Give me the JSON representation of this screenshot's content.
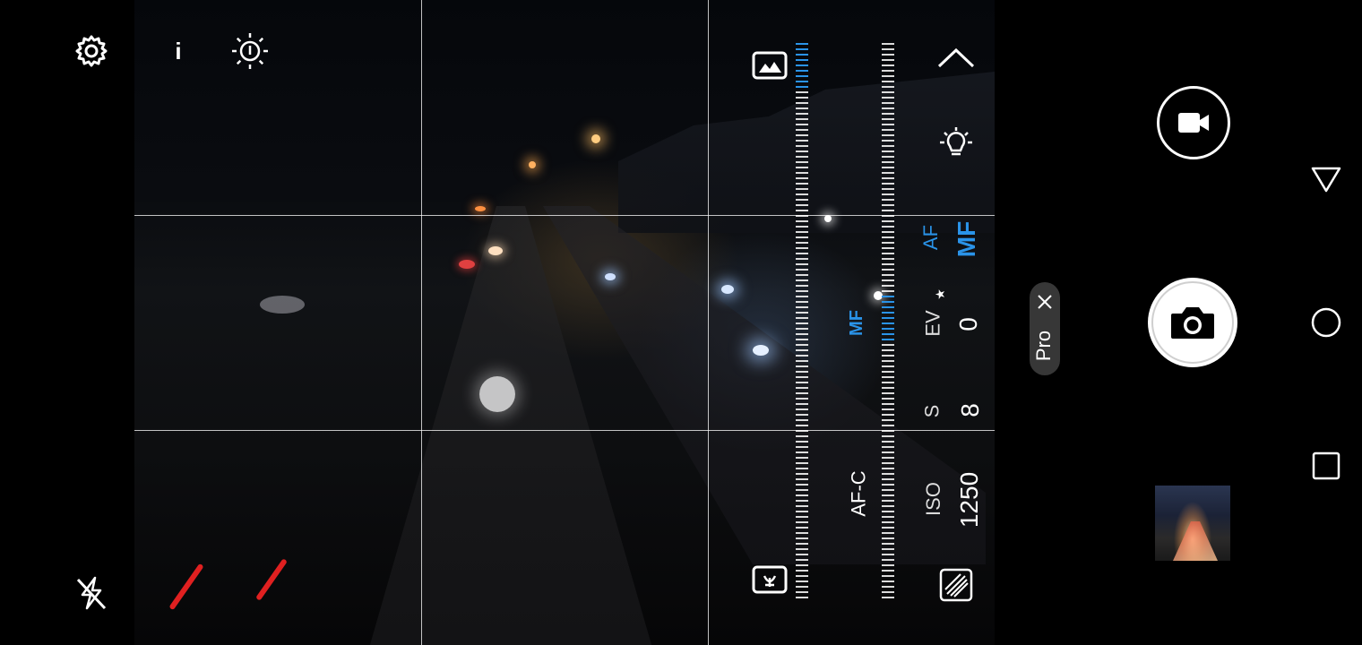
{
  "top_bar": {
    "settings_icon": "gear-icon",
    "info_label": "i",
    "light_icon": "brightness-icon",
    "flash_icon": "flash-off-icon"
  },
  "pro_controls": {
    "mode_icon_top": "landscape-icon",
    "mode_icon_bottom": "macro-flower-icon",
    "collapse_icon": "chevron-up-icon",
    "white_balance_icon": "bulb-icon",
    "focus_mode_icon": "stripe-square-icon",
    "focus": {
      "af_label": "AF",
      "mf_label": "MF",
      "mf_marker": "MF",
      "af_c_label": "AF-C"
    },
    "ev": {
      "label": "EV",
      "value": "0"
    },
    "shutter": {
      "label": "S",
      "value": "8"
    },
    "iso": {
      "label": "ISO",
      "value": "1250"
    }
  },
  "mode_pill": {
    "label": "Pro",
    "close_icon": "close-icon"
  },
  "capture": {
    "video_icon": "video-camera-icon",
    "shutter_icon": "camera-icon",
    "gallery_thumbnail": "gallery-thumbnail"
  },
  "nav_bar": {
    "back_icon": "back-triangle-icon",
    "home_icon": "home-circle-icon",
    "recents_icon": "recents-square-icon"
  },
  "colors": {
    "accent": "#2a93e8",
    "background": "#000000",
    "foreground": "#ffffff",
    "pill": "#3c3c3c"
  }
}
